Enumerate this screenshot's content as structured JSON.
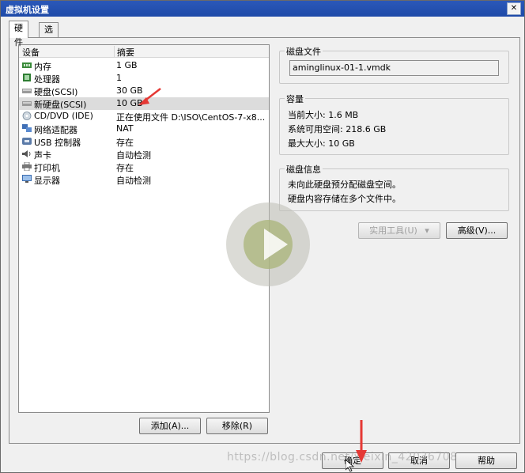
{
  "window": {
    "title": "虚拟机设置",
    "close_label": "✕"
  },
  "tabs": [
    {
      "label": "硬件"
    },
    {
      "label": "选项"
    }
  ],
  "devices": {
    "header": {
      "col1": "设备",
      "col2": "摘要"
    },
    "rows": [
      {
        "name": "内存",
        "summary": "1 GB",
        "icon": "memory-icon"
      },
      {
        "name": "处理器",
        "summary": "1",
        "icon": "processor-icon"
      },
      {
        "name": "硬盘(SCSI)",
        "summary": "30 GB",
        "icon": "hard-disk-icon"
      },
      {
        "name": "新硬盘(SCSI)",
        "summary": "10 GB",
        "icon": "hard-disk-icon"
      },
      {
        "name": "CD/DVD (IDE)",
        "summary": "正在使用文件 D:\\ISO\\CentOS-7-x8...",
        "icon": "cd-dvd-icon"
      },
      {
        "name": "网络适配器",
        "summary": "NAT",
        "icon": "network-icon"
      },
      {
        "name": "USB 控制器",
        "summary": "存在",
        "icon": "usb-icon"
      },
      {
        "name": "声卡",
        "summary": "自动检测",
        "icon": "sound-icon"
      },
      {
        "name": "打印机",
        "summary": "存在",
        "icon": "printer-icon"
      },
      {
        "name": "显示器",
        "summary": "自动检测",
        "icon": "display-icon"
      }
    ],
    "add_label": "添加(A)...",
    "remove_label": "移除(R)"
  },
  "disk_file": {
    "label": "磁盘文件",
    "value": "aminglinux-01-1.vmdk"
  },
  "capacity": {
    "label": "容量",
    "current_size": "当前大小: 1.6 MB",
    "free_space": "系统可用空间: 218.6 GB",
    "max_size": "最大大小: 10 GB"
  },
  "disk_info": {
    "label": "磁盘信息",
    "line1": "未向此硬盘预分配磁盘空间。",
    "line2": "硬盘内容存储在多个文件中。"
  },
  "actions": {
    "utilities_label": "实用工具(U)",
    "advanced_label": "高级(V)..."
  },
  "footer": {
    "ok_label": "确定",
    "cancel_label": "取消",
    "help_label": "帮助"
  },
  "watermark": "https://blog.csdn.net/weixin_42036708"
}
